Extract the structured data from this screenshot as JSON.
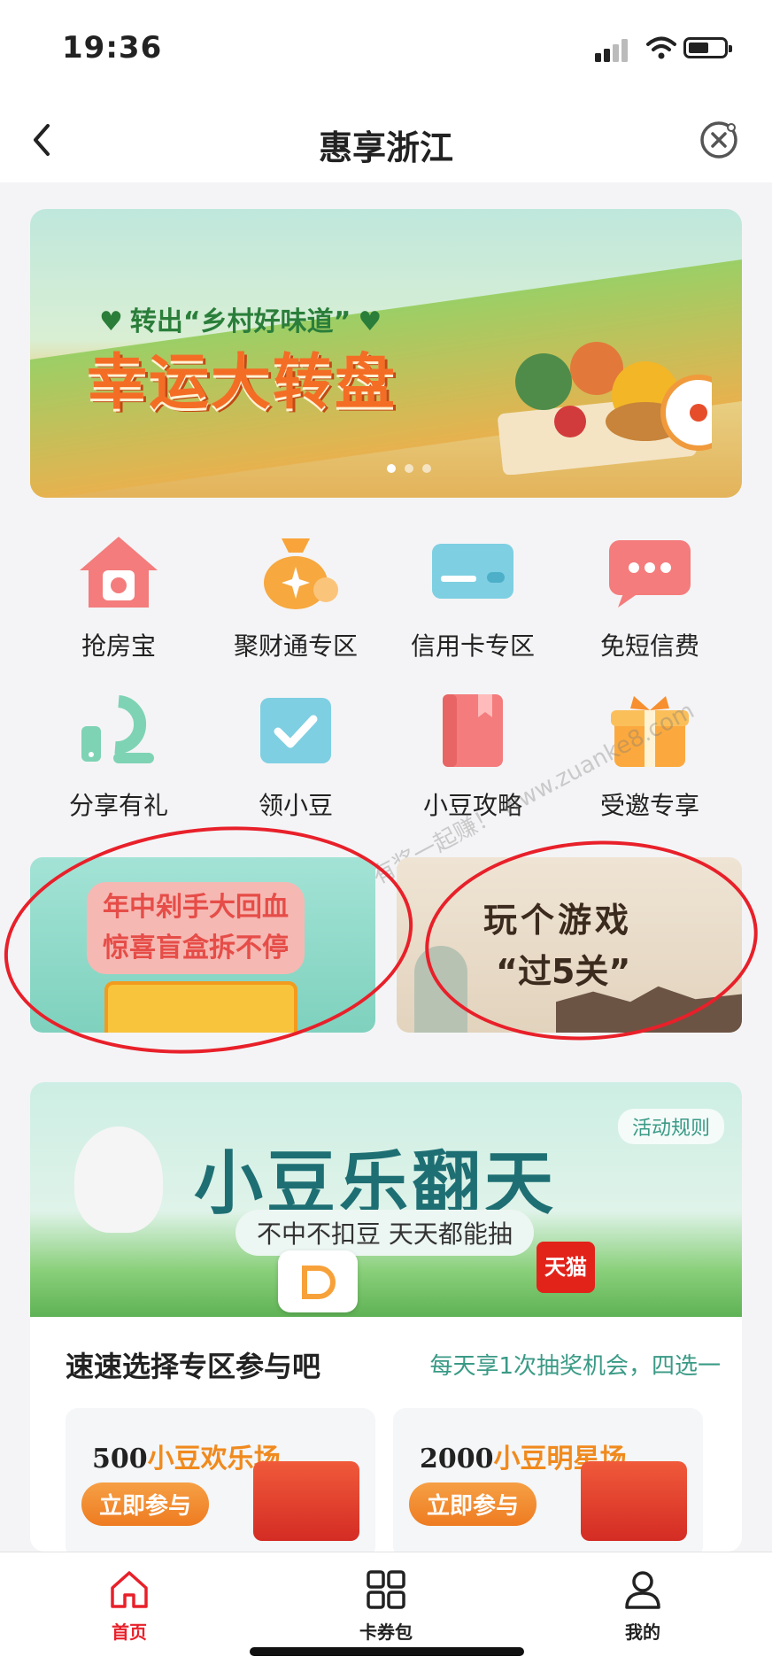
{
  "status": {
    "time": "19:36"
  },
  "nav": {
    "title": "惠享浙江"
  },
  "banner": {
    "subtitle": "转出“乡村好味道”",
    "title": "幸运大转盘"
  },
  "grid": {
    "items": [
      {
        "label": "抢房宝"
      },
      {
        "label": "聚财通专区"
      },
      {
        "label": "信用卡专区"
      },
      {
        "label": "免短信费"
      },
      {
        "label": "分享有礼"
      },
      {
        "label": "领小豆"
      },
      {
        "label": "小豆攻略"
      },
      {
        "label": "受邀专享"
      }
    ]
  },
  "promos": {
    "left": {
      "line1": "年中剁手大回血",
      "line2": "惊喜盲盒拆不停"
    },
    "right": {
      "line1": "玩个游戏",
      "line2": "“过5关”"
    }
  },
  "watermark": "赚客吧，有奖一起赚！ www.zuanke8.com",
  "lottery": {
    "rules": "活动规则",
    "title": "小豆乐翻天",
    "tagline": "不中不扣豆 天天都能抽",
    "tmall": "天猫",
    "section": "速速选择专区参与吧",
    "hint": "每天享1次抽奖机会，四选一",
    "cards": [
      {
        "amount": "500",
        "name": "小豆欢乐场",
        "button": "立即参与"
      },
      {
        "amount": "2000",
        "name": "小豆明星场",
        "button": "立即参与"
      }
    ]
  },
  "tabbar": {
    "tabs": [
      {
        "label": "首页",
        "color": "#e8202a"
      },
      {
        "label": "卡券包",
        "color": "#222222"
      },
      {
        "label": "我的",
        "color": "#222222"
      }
    ]
  }
}
